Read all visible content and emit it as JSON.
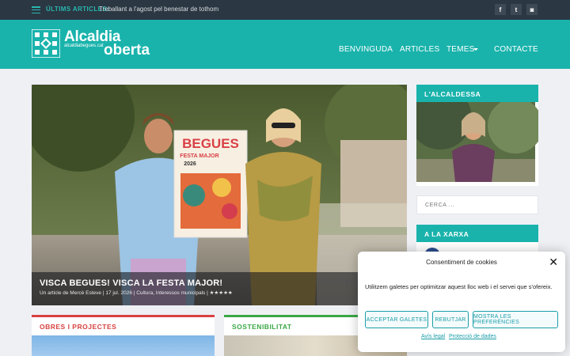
{
  "topbar": {
    "menu_icon": "hamburger-icon",
    "latest_label": "ÚLTIMS ARTICLES:",
    "latest_text": "Treballant a l'agost pel benestar de tothom",
    "social": [
      {
        "icon": "facebook-icon",
        "glyph": "f"
      },
      {
        "icon": "twitter-icon",
        "glyph": "t"
      },
      {
        "icon": "instagram-icon",
        "glyph": "◙"
      }
    ]
  },
  "header": {
    "logo_title": "Alcaldia",
    "logo_title2": "oberta",
    "logo_sub": "alcaldiabegues.cat",
    "nav": [
      "BENVINGUDA",
      "ARTICLES",
      "TEMES",
      "CONTACTE"
    ],
    "colors": {
      "brand": "#19b3ac",
      "topbar": "#2b3742"
    }
  },
  "hero": {
    "title": "VISCA BEGUES! VISCA LA FESTA MAJOR!",
    "meta": "Un article de Mercè Esteve | 17 jul. 2026 | Cultura, Interessos municipals | ★★★★★",
    "poster_title": "BEGUES",
    "poster_sub": "FESTA MAJOR",
    "poster_year": "2026"
  },
  "sidebar": {
    "mayor_heading": "L'ALCALDESSA",
    "search_placeholder": "CERCA ...",
    "network_heading": "A LA XARXA"
  },
  "cards": [
    {
      "label": "OBRES I PROJECTES",
      "color": "#d94040"
    },
    {
      "label": "SOSTENIBILITAT",
      "color": "#3aa845"
    }
  ],
  "cookie": {
    "title": "Consentiment de cookies",
    "text": "Utilitzem galetes per optimitzar aquest lloc web i el servei que s'ofereix.",
    "buttons": [
      "ACCEPTAR GALETES",
      "REBUTJAR",
      "MOSTRA LES PREFERÈNCIES"
    ],
    "links": [
      "Avís legal",
      "Protecció de dades"
    ]
  }
}
